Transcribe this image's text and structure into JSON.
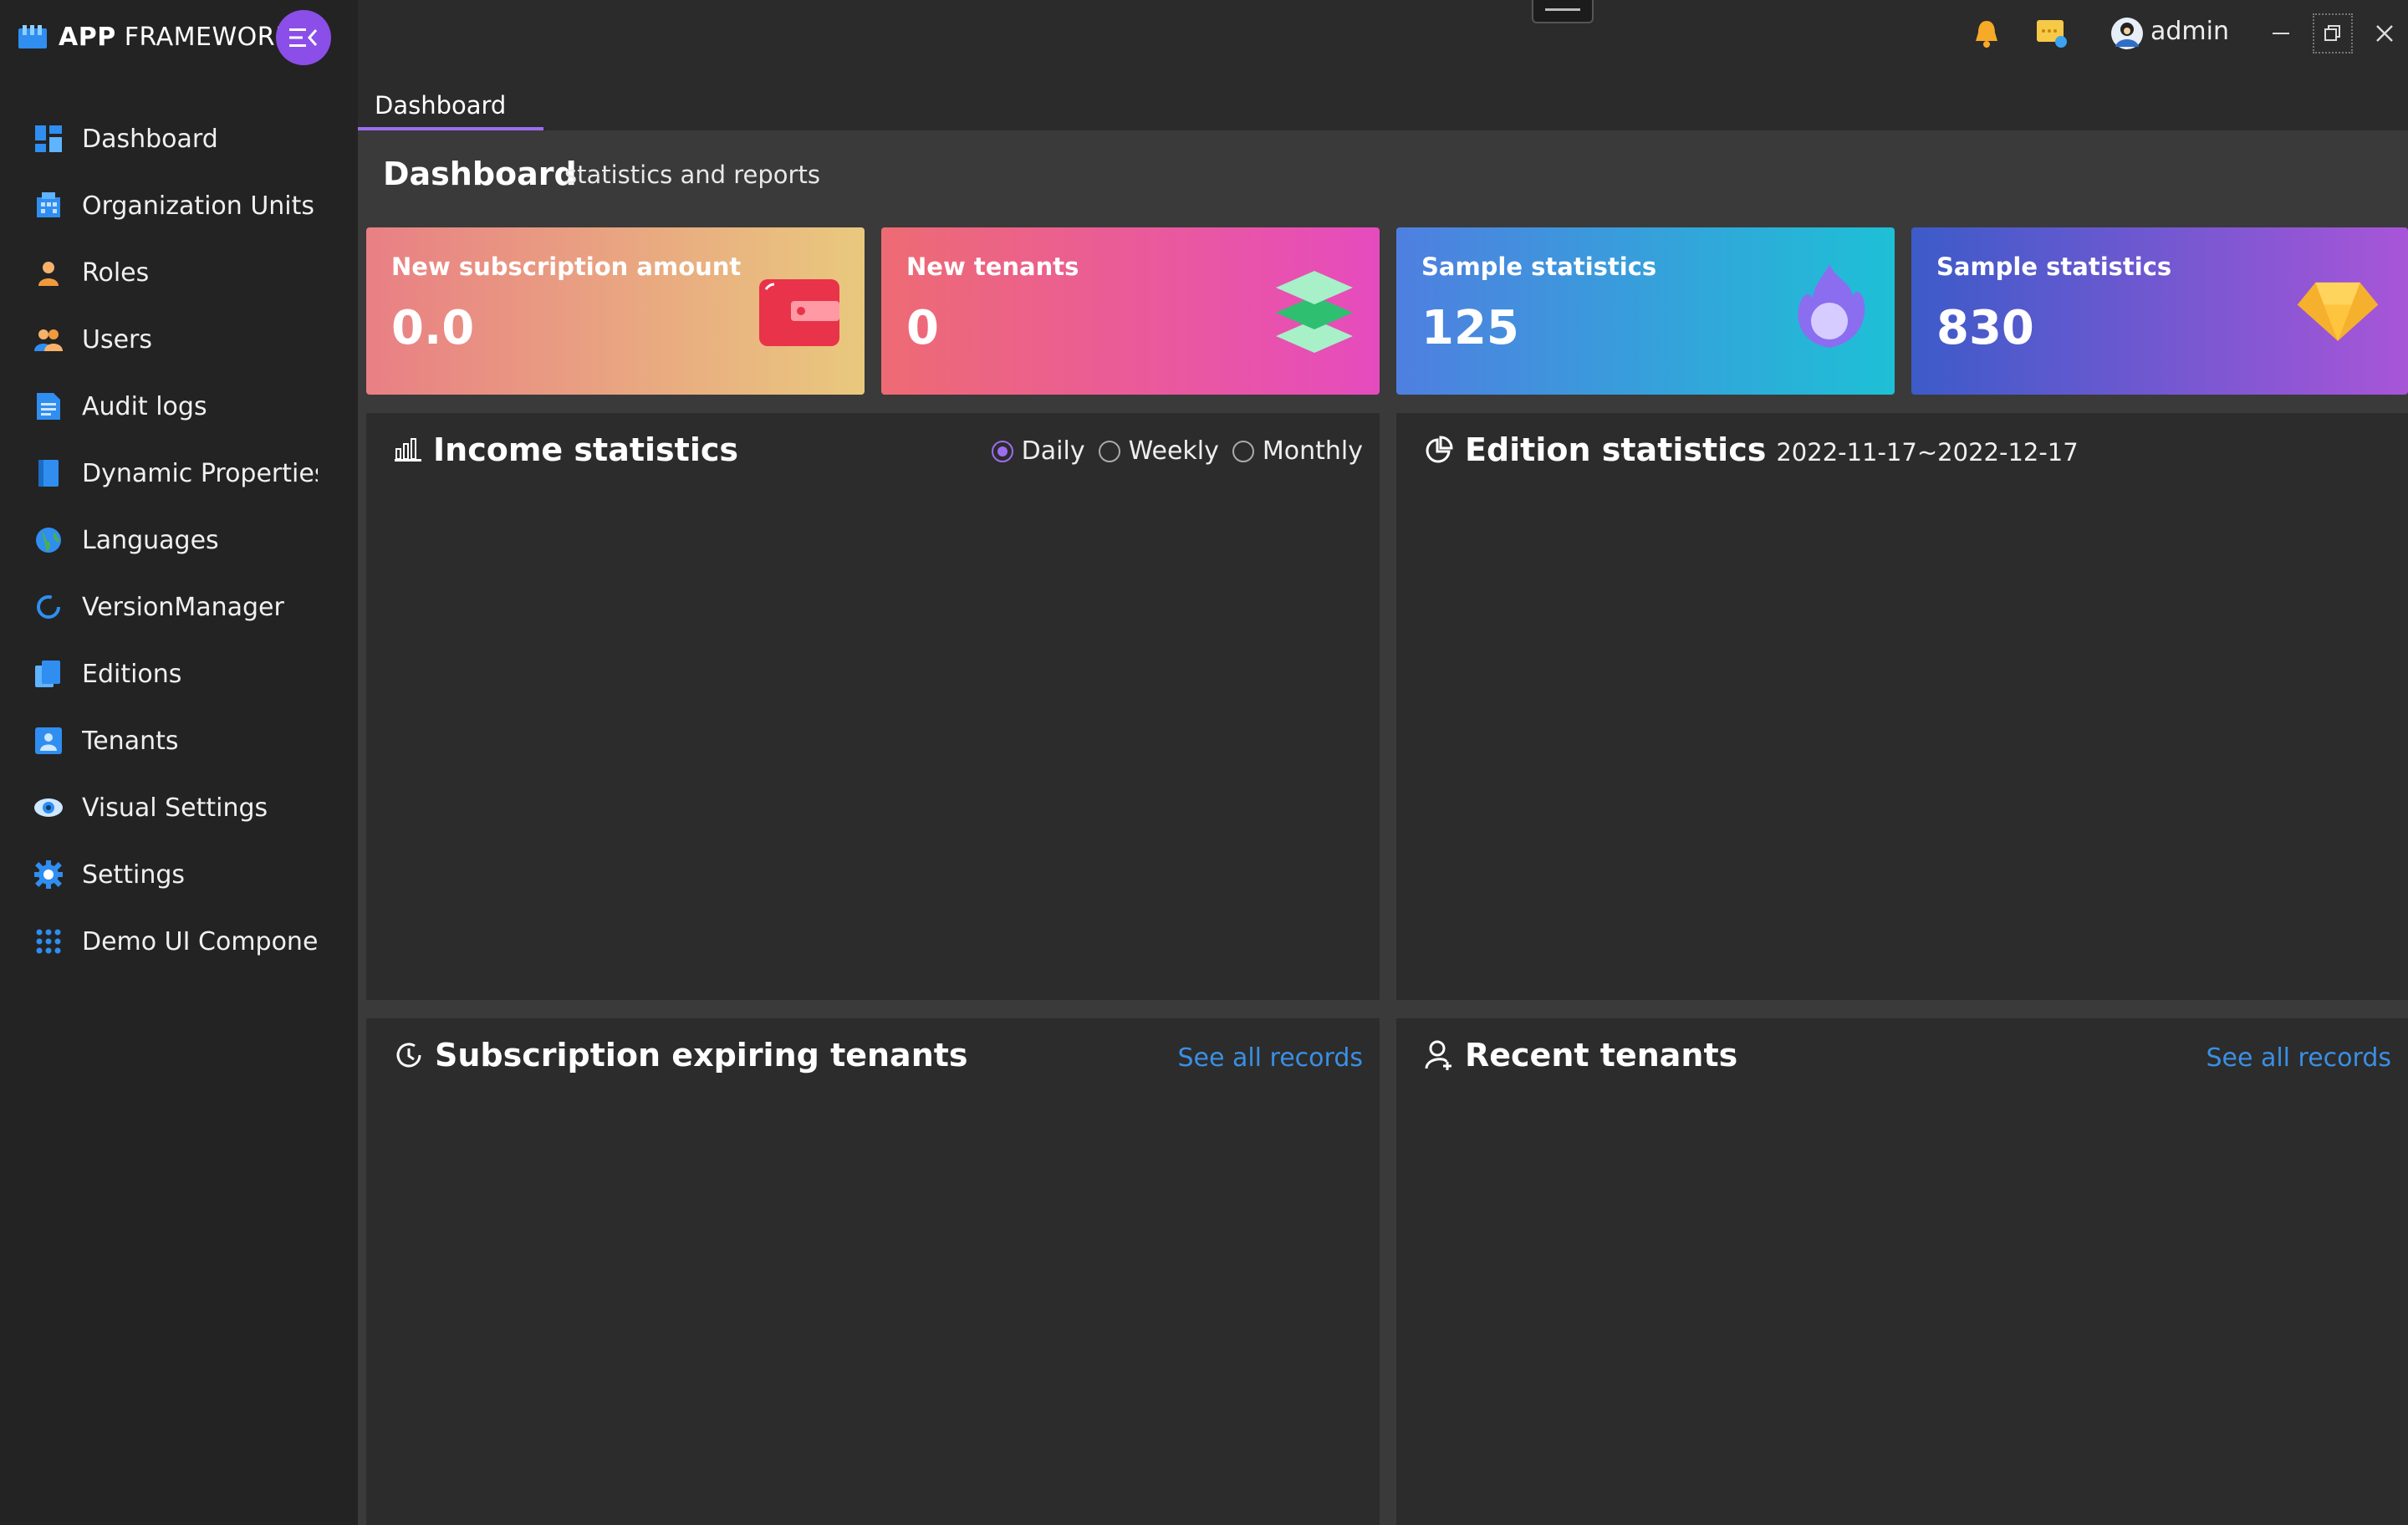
{
  "app": {
    "logo_bold": "APP",
    "logo_rest": " FRAMEWORK"
  },
  "sidebar": {
    "items": [
      {
        "label": "Dashboard",
        "icon": "dashboard-icon"
      },
      {
        "label": "Organization Units",
        "icon": "organization-icon"
      },
      {
        "label": "Roles",
        "icon": "role-icon"
      },
      {
        "label": "Users",
        "icon": "users-icon"
      },
      {
        "label": "Audit logs",
        "icon": "audit-log-icon"
      },
      {
        "label": "Dynamic Properties",
        "icon": "book-icon"
      },
      {
        "label": "Languages",
        "icon": "globe-icon"
      },
      {
        "label": "VersionManager",
        "icon": "refresh-icon"
      },
      {
        "label": "Editions",
        "icon": "editions-icon"
      },
      {
        "label": "Tenants",
        "icon": "tenants-icon"
      },
      {
        "label": "Visual Settings",
        "icon": "eye-icon"
      },
      {
        "label": "Settings",
        "icon": "gear-icon"
      },
      {
        "label": "Demo UI Components",
        "icon": "grid-icon"
      }
    ]
  },
  "topbar": {
    "user": "admin"
  },
  "tabs": [
    {
      "label": "Dashboard",
      "active": true
    }
  ],
  "page": {
    "title": "Dashboard",
    "subtitle": "statistics and reports"
  },
  "cards": [
    {
      "title": "New subscription amount",
      "value": "0.0"
    },
    {
      "title": "New tenants",
      "value": "0"
    },
    {
      "title": "Sample statistics",
      "value": "125"
    },
    {
      "title": "Sample statistics",
      "value": "830"
    }
  ],
  "income": {
    "title": "Income statistics",
    "options": [
      "Daily",
      "Weekly",
      "Monthly"
    ],
    "selected": "Daily"
  },
  "edition": {
    "title": "Edition statistics",
    "range": "2022-11-17~2022-12-17"
  },
  "expiring": {
    "title": "Subscription expiring tenants",
    "link": "See all records"
  },
  "recent": {
    "title": "Recent tenants",
    "link": "See all records"
  },
  "colors": {
    "accent": "#9c6df0",
    "link": "#3b8fe4"
  }
}
